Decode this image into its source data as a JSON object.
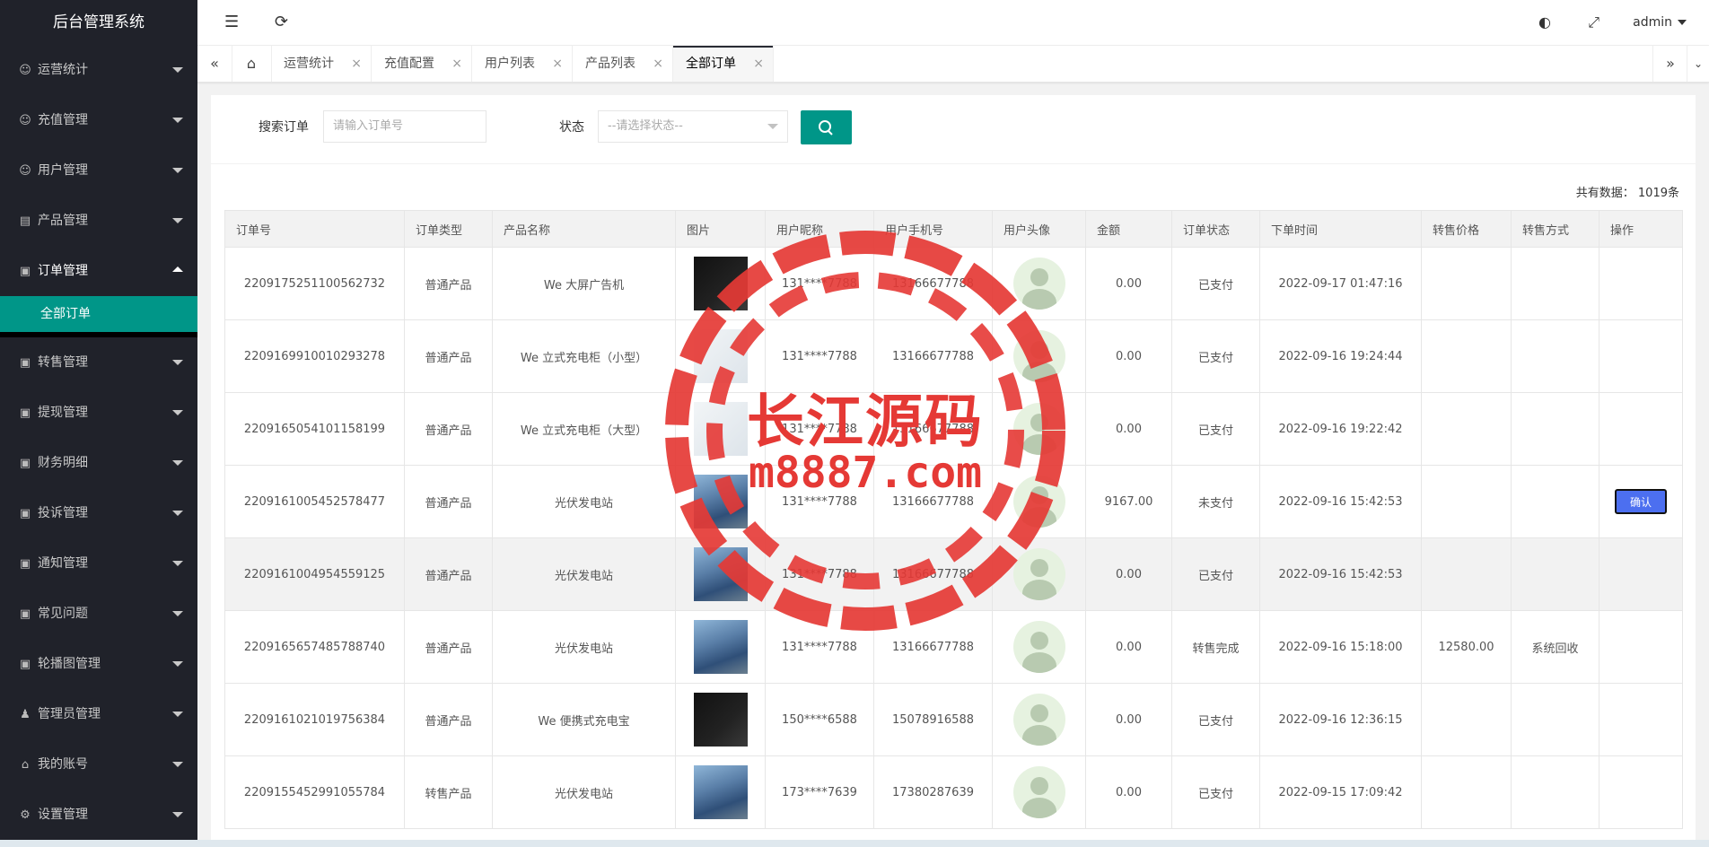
{
  "app": {
    "title": "后台管理系统"
  },
  "header": {
    "user": "admin"
  },
  "sidebar": {
    "items": [
      {
        "label": "运营统计",
        "icon": "user-icon"
      },
      {
        "label": "充值管理",
        "icon": "user-icon"
      },
      {
        "label": "用户管理",
        "icon": "user-icon"
      },
      {
        "label": "产品管理",
        "icon": "doc-icon"
      },
      {
        "label": "订单管理",
        "icon": "image-icon"
      },
      {
        "label": "转售管理",
        "icon": "image-icon"
      },
      {
        "label": "提现管理",
        "icon": "image-icon"
      },
      {
        "label": "财务明细",
        "icon": "image-icon"
      },
      {
        "label": "投诉管理",
        "icon": "image-icon"
      },
      {
        "label": "通知管理",
        "icon": "image-icon"
      },
      {
        "label": "常见问题",
        "icon": "image-icon"
      },
      {
        "label": "轮播图管理",
        "icon": "image-icon"
      },
      {
        "label": "管理员管理",
        "icon": "person-icon"
      },
      {
        "label": "我的账号",
        "icon": "home-icon"
      },
      {
        "label": "设置管理",
        "icon": "gear-icon"
      }
    ],
    "sub_active": "全部订单"
  },
  "tabs": [
    {
      "label": "运营统计"
    },
    {
      "label": "充值配置"
    },
    {
      "label": "用户列表"
    },
    {
      "label": "产品列表"
    },
    {
      "label": "全部订单"
    }
  ],
  "search": {
    "order_label": "搜索订单",
    "order_placeholder": "请输入订单号",
    "status_label": "状态",
    "status_placeholder": "--请选择状态--"
  },
  "total_text": "共有数据： 1019条",
  "table": {
    "headers": [
      "订单号",
      "订单类型",
      "产品名称",
      "图片",
      "用户昵称",
      "用户手机号",
      "用户头像",
      "金额",
      "订单状态",
      "下单时间",
      "转售价格",
      "转售方式",
      "操作"
    ],
    "rows": [
      {
        "order": "2209175251100562732",
        "type": "普通产品",
        "product": "We 大屏广告机",
        "img": "dark",
        "nick": "131****7788",
        "phone": "13166677788",
        "amount": "0.00",
        "status": "已支付",
        "time": "2022-09-17 01:47:16",
        "resale_price": "",
        "resale_way": "",
        "action": ""
      },
      {
        "order": "2209169910010293278",
        "type": "普通产品",
        "product": "We 立式充电柜（小型）",
        "img": "light",
        "nick": "131****7788",
        "phone": "13166677788",
        "amount": "0.00",
        "status": "已支付",
        "time": "2022-09-16 19:24:44",
        "resale_price": "",
        "resale_way": "",
        "action": ""
      },
      {
        "order": "2209165054101158199",
        "type": "普通产品",
        "product": "We 立式充电柜（大型）",
        "img": "light",
        "nick": "131****7788",
        "phone": "13166677788",
        "amount": "0.00",
        "status": "已支付",
        "time": "2022-09-16 19:22:42",
        "resale_price": "",
        "resale_way": "",
        "action": ""
      },
      {
        "order": "2209161005452578477",
        "type": "普通产品",
        "product": "光伏发电站",
        "img": "solar",
        "nick": "131****7788",
        "phone": "13166677788",
        "amount": "9167.00",
        "status": "未支付",
        "time": "2022-09-16 15:42:53",
        "resale_price": "",
        "resale_way": "",
        "action": "确认"
      },
      {
        "order": "2209161004954559125",
        "type": "普通产品",
        "product": "光伏发电站",
        "img": "solar",
        "nick": "131****7788",
        "phone": "13166677788",
        "amount": "0.00",
        "status": "已支付",
        "time": "2022-09-16 15:42:53",
        "resale_price": "",
        "resale_way": "",
        "action": ""
      },
      {
        "order": "2209165657485788740",
        "type": "普通产品",
        "product": "光伏发电站",
        "img": "solar",
        "nick": "131****7788",
        "phone": "13166677788",
        "amount": "0.00",
        "status": "转售完成",
        "time": "2022-09-16 15:18:00",
        "resale_price": "12580.00",
        "resale_way": "系统回收",
        "action": ""
      },
      {
        "order": "2209161021019756384",
        "type": "普通产品",
        "product": "We 便携式充电宝",
        "img": "dark",
        "nick": "150****6588",
        "phone": "15078916588",
        "amount": "0.00",
        "status": "已支付",
        "time": "2022-09-16 12:36:15",
        "resale_price": "",
        "resale_way": "",
        "action": ""
      },
      {
        "order": "2209155452991055784",
        "type": "转售产品",
        "product": "光伏发电站",
        "img": "solar",
        "nick": "173****7639",
        "phone": "17380287639",
        "amount": "0.00",
        "status": "已支付",
        "time": "2022-09-15 17:09:42",
        "resale_price": "",
        "resale_way": "",
        "action": ""
      }
    ]
  },
  "watermark": {
    "line1": "长江源码",
    "line2": "m8887.com"
  },
  "colors": {
    "accent": "#009688",
    "sidebar_bg": "#20222a",
    "watermark": "#e53935",
    "confirm": "#4c6ff0"
  }
}
